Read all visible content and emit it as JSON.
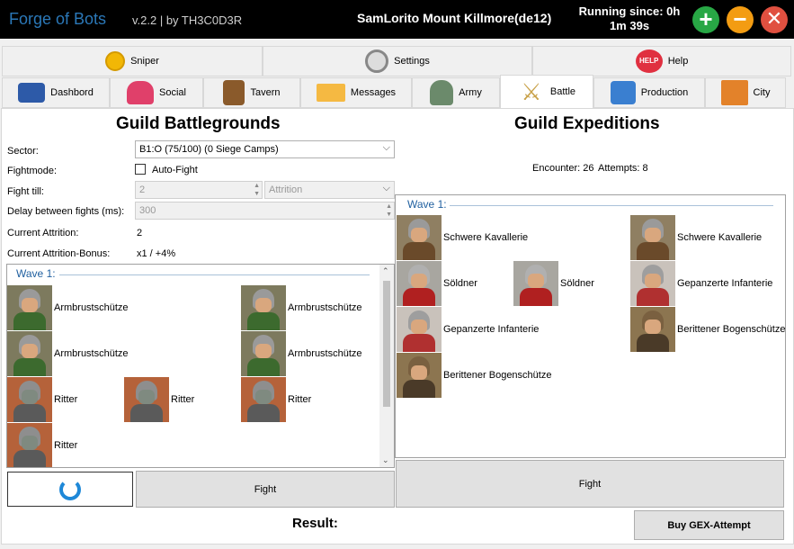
{
  "titlebar": {
    "app_name": "Forge of Bots",
    "version": "v.2.2 | by TH3C0D3R",
    "account": "SamLorito Mount Killmore(de12)",
    "running_line1": "Running since: 0h",
    "running_line2": "1m 39s"
  },
  "tabs_top": [
    {
      "label": "Sniper",
      "icon": "coin-icon"
    },
    {
      "label": "Settings",
      "icon": "settings-icon"
    },
    {
      "label": "Help",
      "icon": "help-icon"
    }
  ],
  "tabs_main": [
    {
      "label": "Dashbord"
    },
    {
      "label": "Social"
    },
    {
      "label": "Tavern"
    },
    {
      "label": "Messages"
    },
    {
      "label": "Army"
    },
    {
      "label": "Battle"
    },
    {
      "label": "Production"
    },
    {
      "label": "City"
    }
  ],
  "gbg": {
    "title": "Guild Battlegrounds",
    "sector_label": "Sector:",
    "sector_value": "B1:O (75/100) (0 Siege Camps)",
    "fightmode_label": "Fightmode:",
    "autofight_label": "Auto-Fight",
    "fight_till_label": "Fight till:",
    "fight_till_value": "2",
    "fight_till_mode": "Attrition",
    "delay_label": "Delay between fights (ms):",
    "delay_value": "300",
    "attrition_label": "Current Attrition:",
    "attrition_value": "2",
    "bonus_label": "Current Attrition-Bonus:",
    "bonus_value": "x1 / +4%",
    "wave_label": "Wave 1:",
    "units": [
      "Armbrustschütze",
      "Armbrustschütze",
      "Armbrustschütze",
      "Armbrustschütze",
      "Ritter",
      "Ritter",
      "Ritter",
      "Ritter"
    ],
    "fight_label": "Fight",
    "result_label": "Result:"
  },
  "gex": {
    "title": "Guild Expeditions",
    "encounter": "Encounter: 26",
    "attempts": "Attempts: 8",
    "wave_label": "Wave 1:",
    "units": [
      "Schwere Kavallerie",
      "Schwere Kavallerie",
      "Söldner",
      "Söldner",
      "Gepanzerte Infanterie",
      "Gepanzerte Infanterie",
      "Berittener Bogenschütze",
      "Berittener Bogenschütze"
    ],
    "fight_label": "Fight",
    "buy_label": "Buy GEX-Attempt"
  }
}
